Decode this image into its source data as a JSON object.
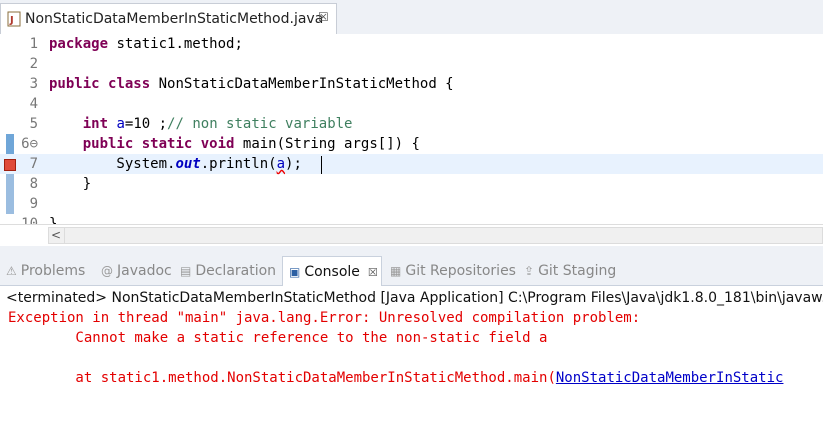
{
  "editor_tab": {
    "title": "NonStaticDataMemberInStaticMethod.java",
    "close": "☒"
  },
  "editor": {
    "lines": [
      {
        "n": "1",
        "parts": [
          {
            "t": "package",
            "c": "kw"
          },
          {
            "t": " static1.method;",
            "c": ""
          }
        ]
      },
      {
        "n": "2",
        "parts": []
      },
      {
        "n": "3",
        "parts": [
          {
            "t": "public",
            "c": "kw"
          },
          {
            "t": " ",
            "c": ""
          },
          {
            "t": "class",
            "c": "kw"
          },
          {
            "t": " NonStaticDataMemberInStaticMethod {",
            "c": ""
          }
        ]
      },
      {
        "n": "4",
        "parts": []
      },
      {
        "n": "5",
        "parts": [
          {
            "t": "    ",
            "c": ""
          },
          {
            "t": "int",
            "c": "kw"
          },
          {
            "t": " ",
            "c": ""
          },
          {
            "t": "a",
            "c": "fld"
          },
          {
            "t": "=10 ;",
            "c": ""
          },
          {
            "t": "// non static variable",
            "c": "cm"
          }
        ]
      },
      {
        "n": "6⊖",
        "parts": [
          {
            "t": "    ",
            "c": ""
          },
          {
            "t": "public",
            "c": "kw"
          },
          {
            "t": " ",
            "c": ""
          },
          {
            "t": "static",
            "c": "kw"
          },
          {
            "t": " ",
            "c": ""
          },
          {
            "t": "void",
            "c": "kw"
          },
          {
            "t": " main(String ",
            "c": ""
          },
          {
            "t": "args",
            "c": ""
          },
          {
            "t": "[]) {",
            "c": ""
          }
        ]
      },
      {
        "n": "7",
        "parts": [
          {
            "t": "        System.",
            "c": ""
          },
          {
            "t": "out",
            "c": "sfld"
          },
          {
            "t": ".println(",
            "c": ""
          },
          {
            "t": "a",
            "c": "fld err"
          },
          {
            "t": ");",
            "c": ""
          }
        ],
        "highlight": true
      },
      {
        "n": "8",
        "parts": [
          {
            "t": "    }",
            "c": ""
          }
        ]
      },
      {
        "n": "9",
        "parts": []
      },
      {
        "n": "10",
        "parts": [
          {
            "t": "}",
            "c": ""
          }
        ]
      }
    ]
  },
  "scrollbar": {
    "left_arrow": "<"
  },
  "views_tabs": [
    {
      "label": "Problems",
      "icon": "problems-icon",
      "glyph": "⚠",
      "active": false
    },
    {
      "label": "Javadoc",
      "icon": "javadoc-icon",
      "glyph": "@",
      "active": false
    },
    {
      "label": "Declaration",
      "icon": "declaration-icon",
      "glyph": "▤",
      "active": false
    },
    {
      "label": "Console",
      "icon": "console-icon",
      "glyph": "▣",
      "active": true,
      "close": "☒"
    },
    {
      "label": "Git Repositories",
      "icon": "git-repositories-icon",
      "glyph": "▦",
      "active": false
    },
    {
      "label": "Git Staging",
      "icon": "git-staging-icon",
      "glyph": "⇪",
      "active": false
    }
  ],
  "console": {
    "status": "<terminated> NonStaticDataMemberInStaticMethod [Java Application] C:\\Program Files\\Java\\jdk1.8.0_181\\bin\\javaw.exe  (",
    "line1": "Exception in thread \"main\" java.lang.Error: Unresolved compilation problem: ",
    "line2": "        Cannot make a static reference to the non-static field a",
    "line3_prefix": "        at static1.method.NonStaticDataMemberInStaticMethod.main(",
    "line3_link": "NonStaticDataMemberInStatic"
  },
  "colors": {
    "keyword": "#7f0055",
    "comment": "#3f7f5f",
    "field": "#0000c0",
    "console_error": "#e30000",
    "console_link": "#0000c8",
    "gutter_marker": "#6fa6d8"
  }
}
